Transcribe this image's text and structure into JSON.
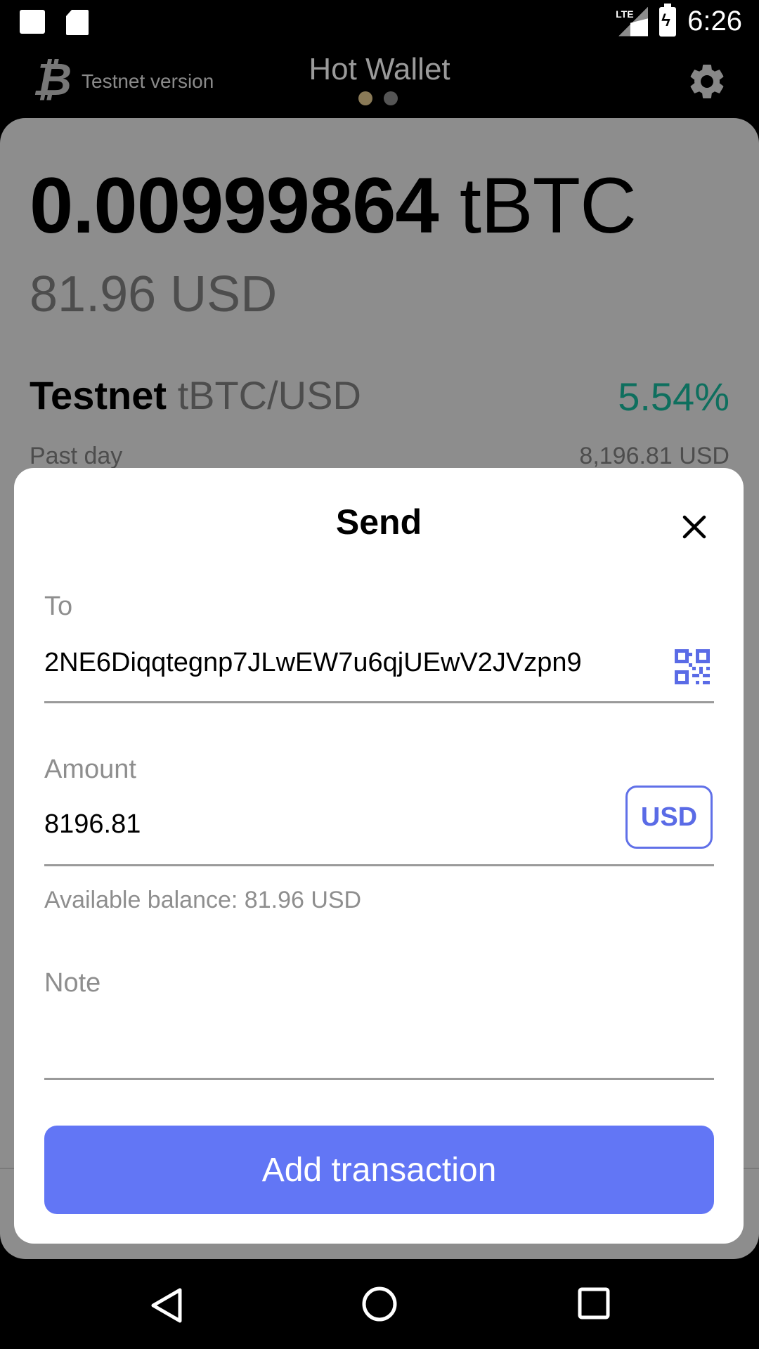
{
  "status_bar": {
    "network": "LTE",
    "time": "6:26"
  },
  "header": {
    "logo": "₿",
    "version_label": "Testnet version",
    "title": "Hot Wallet",
    "page_indicator": [
      "active",
      "inactive"
    ],
    "settings_icon": "gear-icon"
  },
  "wallet": {
    "balance_amount": "0.00999864",
    "balance_unit": "tBTC",
    "fiat_balance": "81.96 USD",
    "network_name": "Testnet",
    "pair": "tBTC/USD",
    "change_percent": "5.54%",
    "period_label": "Past day",
    "price": "8,196.81 USD"
  },
  "send_modal": {
    "title": "Send",
    "to_label": "To",
    "to_value": "2NE6Diqqtegnp7JLwEW7u6qjUEwV2JVzpn9",
    "amount_label": "Amount",
    "amount_value": "8196.81",
    "currency_toggle": "USD",
    "available_balance": "Available balance: 81.96 USD",
    "note_label": "Note",
    "note_value": "",
    "submit_label": "Add transaction"
  },
  "colors": {
    "accent": "#6276f5",
    "positive": "#0e6f5e",
    "dim_overlay": "#8d8d8d"
  }
}
